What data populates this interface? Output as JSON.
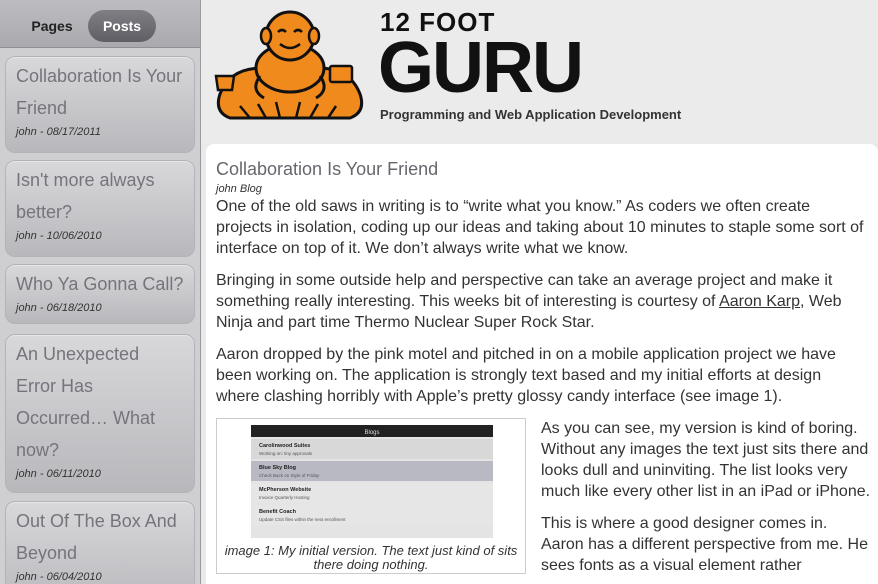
{
  "sidebar": {
    "tabs": [
      {
        "label": "Pages"
      },
      {
        "label": "Posts"
      }
    ],
    "posts": [
      {
        "title": "Collaboration Is Your Friend",
        "meta": "john - 08/17/2011"
      },
      {
        "title": "Isn't more always better?",
        "meta": "john - 10/06/2010"
      },
      {
        "title": "Who Ya Gonna Call?",
        "meta": "john - 06/18/2010"
      },
      {
        "title": "An Unexpected Error Has Occurred… What now?",
        "meta": "john - 06/11/2010"
      },
      {
        "title": "Out Of The Box And Beyond",
        "meta": "john - 06/04/2010"
      }
    ]
  },
  "header": {
    "brand_small": "12 FOOT",
    "brand_big": "GURU",
    "tagline": "Programming and Web Application Development",
    "logo_icon": "guru-mascot-icon",
    "brand_color": "#f08a1c"
  },
  "post": {
    "title": "Collaboration Is Your Friend",
    "meta": "john Blog",
    "p1": "One of the old saws in writing is to “write what you know.” As coders we often create projects in isolation, coding up our ideas and taking about 10 minutes to staple some sort of interface on top of it.  We don’t always write what we know.",
    "p2_before": "Bringing in some outside help and perspective can take an average project and make it something really interesting. This weeks bit of interesting is courtesy of ",
    "p2_link": "Aaron Karp",
    "p2_after": ", Web Ninja and part time Thermo Nuclear Super Rock Star.",
    "p3": "Aaron dropped by the pink motel and pitched in on a mobile application project we have been working on. The application is strongly text based and my initial efforts at design where clashing horribly with Apple’s pretty glossy candy interface (see image 1).",
    "figure_caption": "image 1: My initial version. The text just kind of sits there doing nothing.",
    "p4": "As you can see, my version is kind of boring. Without any images the text just sits there and looks dull and uninviting. The list looks very much like every other list in an iPad or iPhone.",
    "p5": "This is where a good designer comes in. Aaron has a different perspective from me. He sees fonts as a visual element rather"
  },
  "figure_screenshot": {
    "title": "Blogs",
    "rows": [
      {
        "title": "Carolinwood Suites",
        "sub": "Working on: tiny approvals"
      },
      {
        "title": "Blue Sky Blog",
        "sub": "Check Back on Style of Friday"
      },
      {
        "title": "McPherson Website",
        "sub": "Invoice Quarterly Hosting"
      },
      {
        "title": "Benefit Coach",
        "sub": "Update CSS files within the next enrollment"
      }
    ]
  }
}
